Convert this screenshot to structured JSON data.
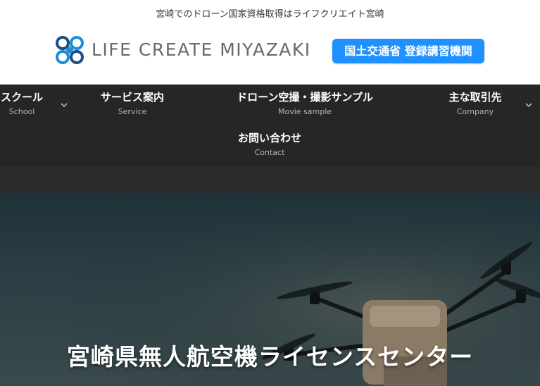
{
  "header": {
    "tagline": "宮崎でのドローン国家資格取得はライフクリエイト宮崎",
    "logo_text": "LIFE CREATE MIYAZAKI",
    "badge": "国土交通省 登録講習機関"
  },
  "nav": {
    "items": [
      {
        "jp": "スクール",
        "en": "School"
      },
      {
        "jp": "サービス案内",
        "en": "Service"
      },
      {
        "jp": "ドローン空撮・撮影サンプル",
        "en": "Movie sample"
      },
      {
        "jp": "主な取引先",
        "en": "Company"
      },
      {
        "jp": "お問い合わせ",
        "en": "Contact"
      }
    ]
  },
  "hero": {
    "title": "宮崎県無人航空機ライセンスセンター"
  },
  "colors": {
    "nav_bg": "#262626",
    "badge_bg": "#1e90ff",
    "logo_blue": "#1b8fd6",
    "logo_dark": "#1a4f86"
  }
}
